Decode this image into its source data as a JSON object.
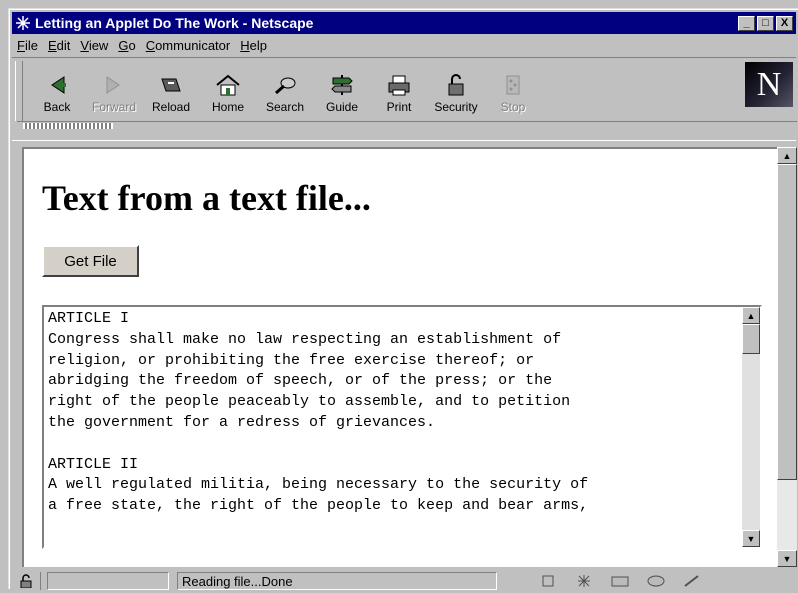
{
  "window": {
    "title": "Letting an Applet Do The Work - Netscape",
    "controls": {
      "minimize": "_",
      "maximize": "□",
      "close": "X"
    }
  },
  "menu": [
    {
      "accel": "F",
      "rest": "ile"
    },
    {
      "accel": "E",
      "rest": "dit"
    },
    {
      "accel": "V",
      "rest": "iew"
    },
    {
      "accel": "G",
      "rest": "o"
    },
    {
      "accel": "C",
      "rest": "ommunicator"
    },
    {
      "accel": "H",
      "rest": "elp"
    }
  ],
  "toolbar": {
    "back": "Back",
    "forward": "Forward",
    "reload": "Reload",
    "home": "Home",
    "search": "Search",
    "guide": "Guide",
    "print": "Print",
    "security": "Security",
    "stop": "Stop",
    "logo": "N"
  },
  "page": {
    "title": "Text from a text file...",
    "button_label": "Get File",
    "text_lines": [
      "ARTICLE I",
      "Congress shall make no law respecting an establishment of",
      "religion, or prohibiting the free exercise thereof; or",
      "abridging the freedom of speech, or of the press; or the",
      "right of the people peaceably to assemble, and to petition",
      "the government for a redress of grievances.",
      "",
      "ARTICLE II",
      "A well regulated militia, being necessary to the security of",
      "a free state, the right of the people to keep and bear arms,"
    ]
  },
  "status": {
    "text": "Reading file...Done"
  },
  "colors": {
    "titlebar": "#000080",
    "chrome": "#c0c0c0"
  }
}
